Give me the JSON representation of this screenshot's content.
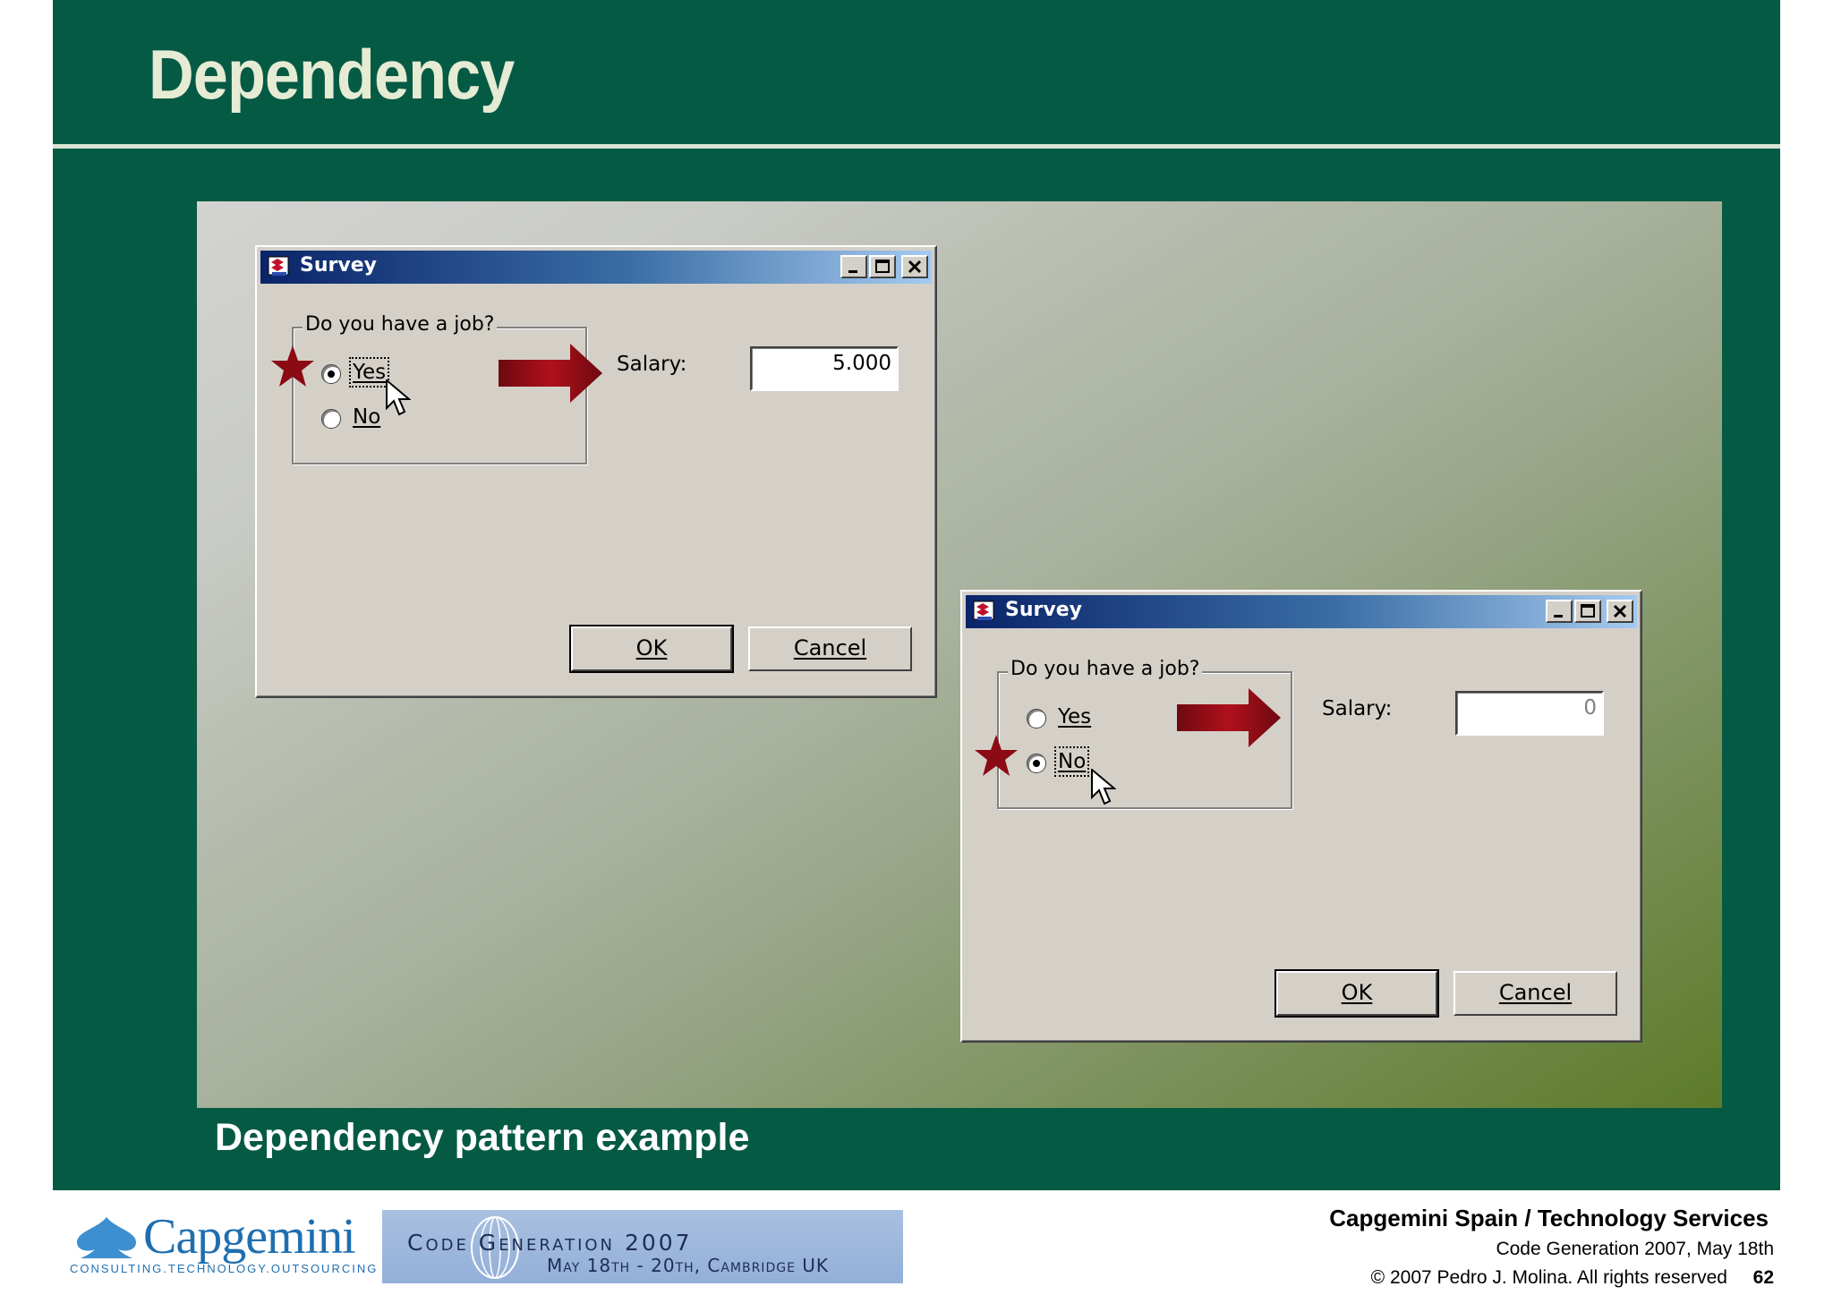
{
  "slide": {
    "title": "Dependency",
    "caption": "Dependency pattern example",
    "page_number": "62"
  },
  "dialogs": [
    {
      "title": "Survey",
      "group_label": "Do you have a job?",
      "options": [
        {
          "label": "Yes",
          "checked": true
        },
        {
          "label": "No",
          "checked": false
        }
      ],
      "salary_label": "Salary:",
      "salary_value": "5.000",
      "ok_label": "OK",
      "cancel_label": "Cancel"
    },
    {
      "title": "Survey",
      "group_label": "Do you have a job?",
      "options": [
        {
          "label": "Yes",
          "checked": false
        },
        {
          "label": "No",
          "checked": true
        }
      ],
      "salary_label": "Salary:",
      "salary_value": "0",
      "ok_label": "OK",
      "cancel_label": "Cancel"
    }
  ],
  "footer": {
    "company": "Capgemini Spain / Technology Services",
    "event": "Code Generation 2007, May 18th",
    "copyright": "© 2007 Pedro J. Molina. All rights reserved"
  },
  "logos": {
    "capgemini_word": "Capgemini",
    "capgemini_tagline": "CONSULTING.TECHNOLOGY.OUTSOURCING",
    "conference_name": "Code Generation 2007",
    "conference_dates": "May 18th - 20th, Cambridge UK"
  },
  "colors": {
    "slide_green": "#055a44",
    "title_text": "#e6ebd4",
    "marker_red": "#8b0a14",
    "titlebar_start": "#0a246a",
    "titlebar_end": "#a6caf0"
  }
}
